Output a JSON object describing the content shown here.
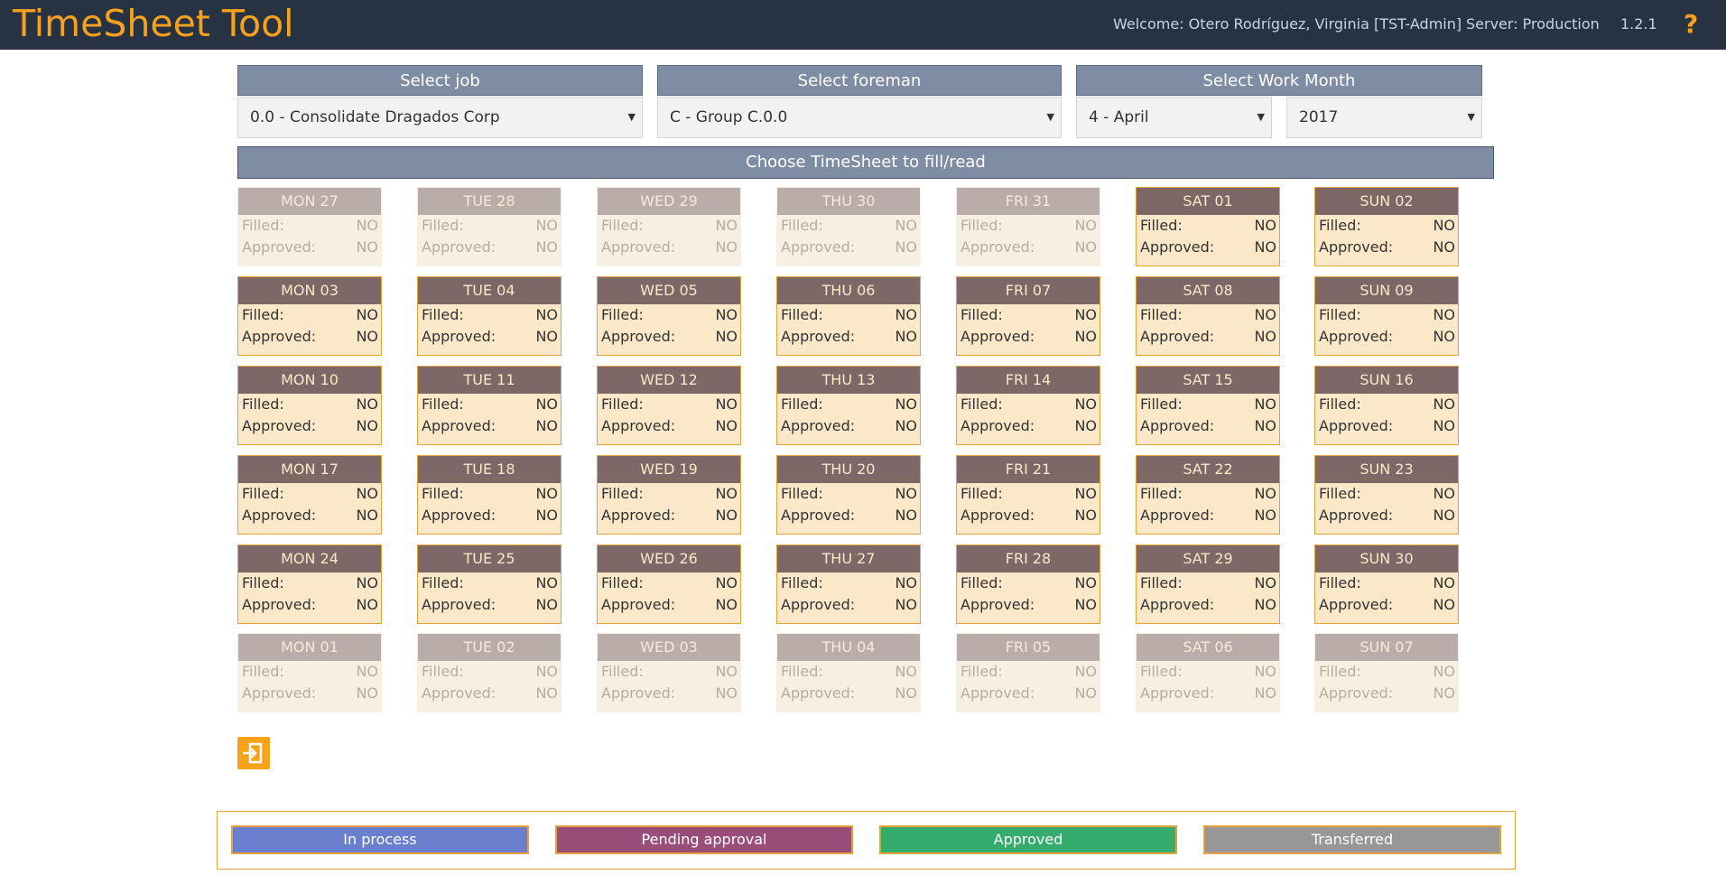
{
  "header": {
    "app_title": "TimeSheet Tool",
    "welcome": "Welcome: Otero Rodríguez, Virginia [TST-Admin]",
    "server": "Server: Production",
    "version": "1.2.1",
    "help_icon": "?"
  },
  "filters": {
    "job": {
      "label": "Select job",
      "value": "0.0 - Consolidate Dragados Corp"
    },
    "foreman": {
      "label": "Select foreman",
      "value": "C - Group C.0.0"
    },
    "work_month": {
      "label": "Select Work Month",
      "month_value": "4 - April",
      "year_value": "2017"
    }
  },
  "calendar": {
    "title": "Choose TimeSheet to fill/read",
    "filled_label": "Filled:",
    "approved_label": "Approved:",
    "weeks": [
      [
        {
          "day": "MON 27",
          "filled": "NO",
          "approved": "NO",
          "in_month": false
        },
        {
          "day": "TUE 28",
          "filled": "NO",
          "approved": "NO",
          "in_month": false
        },
        {
          "day": "WED 29",
          "filled": "NO",
          "approved": "NO",
          "in_month": false
        },
        {
          "day": "THU 30",
          "filled": "NO",
          "approved": "NO",
          "in_month": false
        },
        {
          "day": "FRI 31",
          "filled": "NO",
          "approved": "NO",
          "in_month": false
        },
        {
          "day": "SAT 01",
          "filled": "NO",
          "approved": "NO",
          "in_month": true
        },
        {
          "day": "SUN 02",
          "filled": "NO",
          "approved": "NO",
          "in_month": true
        }
      ],
      [
        {
          "day": "MON 03",
          "filled": "NO",
          "approved": "NO",
          "in_month": true
        },
        {
          "day": "TUE 04",
          "filled": "NO",
          "approved": "NO",
          "in_month": true
        },
        {
          "day": "WED 05",
          "filled": "NO",
          "approved": "NO",
          "in_month": true
        },
        {
          "day": "THU 06",
          "filled": "NO",
          "approved": "NO",
          "in_month": true
        },
        {
          "day": "FRI 07",
          "filled": "NO",
          "approved": "NO",
          "in_month": true
        },
        {
          "day": "SAT 08",
          "filled": "NO",
          "approved": "NO",
          "in_month": true
        },
        {
          "day": "SUN 09",
          "filled": "NO",
          "approved": "NO",
          "in_month": true
        }
      ],
      [
        {
          "day": "MON 10",
          "filled": "NO",
          "approved": "NO",
          "in_month": true
        },
        {
          "day": "TUE 11",
          "filled": "NO",
          "approved": "NO",
          "in_month": true
        },
        {
          "day": "WED 12",
          "filled": "NO",
          "approved": "NO",
          "in_month": true
        },
        {
          "day": "THU 13",
          "filled": "NO",
          "approved": "NO",
          "in_month": true
        },
        {
          "day": "FRI 14",
          "filled": "NO",
          "approved": "NO",
          "in_month": true
        },
        {
          "day": "SAT 15",
          "filled": "NO",
          "approved": "NO",
          "in_month": true
        },
        {
          "day": "SUN 16",
          "filled": "NO",
          "approved": "NO",
          "in_month": true
        }
      ],
      [
        {
          "day": "MON 17",
          "filled": "NO",
          "approved": "NO",
          "in_month": true
        },
        {
          "day": "TUE 18",
          "filled": "NO",
          "approved": "NO",
          "in_month": true
        },
        {
          "day": "WED 19",
          "filled": "NO",
          "approved": "NO",
          "in_month": true
        },
        {
          "day": "THU 20",
          "filled": "NO",
          "approved": "NO",
          "in_month": true
        },
        {
          "day": "FRI 21",
          "filled": "NO",
          "approved": "NO",
          "in_month": true
        },
        {
          "day": "SAT 22",
          "filled": "NO",
          "approved": "NO",
          "in_month": true
        },
        {
          "day": "SUN 23",
          "filled": "NO",
          "approved": "NO",
          "in_month": true
        }
      ],
      [
        {
          "day": "MON 24",
          "filled": "NO",
          "approved": "NO",
          "in_month": true
        },
        {
          "day": "TUE 25",
          "filled": "NO",
          "approved": "NO",
          "in_month": true
        },
        {
          "day": "WED 26",
          "filled": "NO",
          "approved": "NO",
          "in_month": true
        },
        {
          "day": "THU 27",
          "filled": "NO",
          "approved": "NO",
          "in_month": true
        },
        {
          "day": "FRI 28",
          "filled": "NO",
          "approved": "NO",
          "in_month": true
        },
        {
          "day": "SAT 29",
          "filled": "NO",
          "approved": "NO",
          "in_month": true
        },
        {
          "day": "SUN 30",
          "filled": "NO",
          "approved": "NO",
          "in_month": true
        }
      ],
      [
        {
          "day": "MON 01",
          "filled": "NO",
          "approved": "NO",
          "in_month": false
        },
        {
          "day": "TUE 02",
          "filled": "NO",
          "approved": "NO",
          "in_month": false
        },
        {
          "day": "WED 03",
          "filled": "NO",
          "approved": "NO",
          "in_month": false
        },
        {
          "day": "THU 04",
          "filled": "NO",
          "approved": "NO",
          "in_month": false
        },
        {
          "day": "FRI 05",
          "filled": "NO",
          "approved": "NO",
          "in_month": false
        },
        {
          "day": "SAT 06",
          "filled": "NO",
          "approved": "NO",
          "in_month": false
        },
        {
          "day": "SUN 07",
          "filled": "NO",
          "approved": "NO",
          "in_month": false
        }
      ]
    ]
  },
  "exit_button_icon": "exit-icon",
  "legend": [
    {
      "label": "In process",
      "color": "#6a80cf"
    },
    {
      "label": "Pending approval",
      "color": "#9b4d7a"
    },
    {
      "label": "Approved",
      "color": "#35ab6e"
    },
    {
      "label": "Transferred",
      "color": "#979797"
    }
  ]
}
